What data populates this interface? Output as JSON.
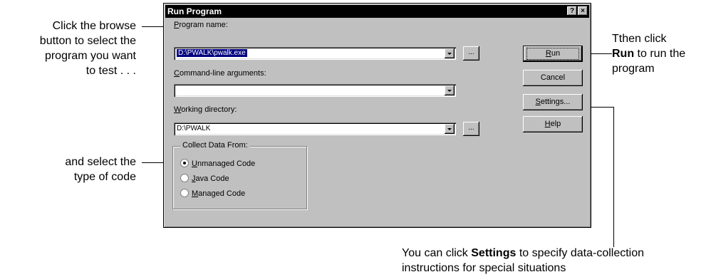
{
  "callouts": {
    "browse": [
      "Click the browse",
      "button to select the",
      "program you want",
      "to test . . ."
    ],
    "code_type": [
      "and select the",
      "type of code"
    ],
    "run": {
      "line1": "Tthen click",
      "bold": "Run",
      "line2_rest": " to run the",
      "line3": "program"
    },
    "settings": {
      "bold": "Settings",
      "line1_rest": " to specify data-collection",
      "prefix": "You can click ",
      "line2": "instructions for special situations"
    }
  },
  "dialog": {
    "title": "Run Program",
    "help_glyph": "?",
    "close_glyph": "×",
    "program_name": {
      "hotkey": "P",
      "rest": "rogram name:",
      "value": "D:\\PWALK\\pwalk.exe"
    },
    "args": {
      "hotkey": "C",
      "rest": "ommand-line arguments:",
      "value": ""
    },
    "workdir": {
      "hotkey": "W",
      "rest": "orking directory:",
      "value": "D:\\PWALK"
    },
    "browse_label": "...",
    "buttons": {
      "run": {
        "hotkey": "R",
        "rest": "un"
      },
      "cancel": "Cancel",
      "settings": {
        "hotkey": "S",
        "rest": "ettings..."
      },
      "help": {
        "hotkey": "H",
        "rest": "elp"
      }
    },
    "collect": {
      "title": "Collect Data From:",
      "options": [
        {
          "hotkey": "U",
          "rest": "nmanaged Code",
          "selected": true
        },
        {
          "hotkey": "J",
          "rest": "ava Code",
          "selected": false
        },
        {
          "hotkey": "M",
          "rest": "anaged Code",
          "selected": false
        }
      ]
    }
  }
}
